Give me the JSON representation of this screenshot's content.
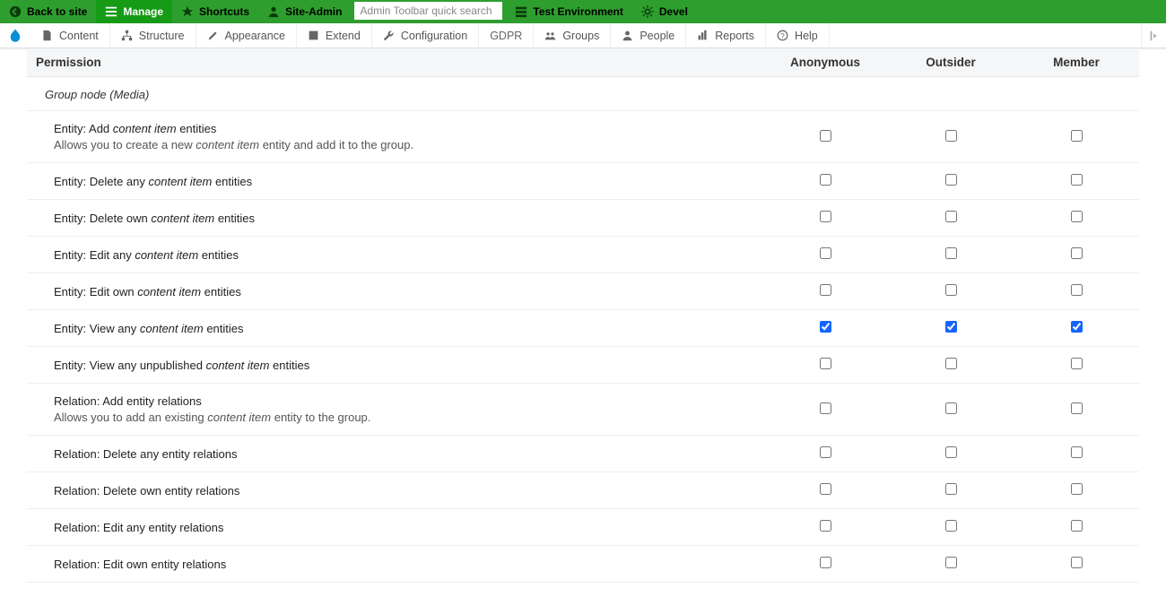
{
  "toolbar_top": {
    "back": "Back to site",
    "manage": "Manage",
    "shortcuts": "Shortcuts",
    "site_admin": "Site-Admin",
    "search_placeholder": "Admin Toolbar quick search",
    "test_env": "Test Environment",
    "devel": "Devel"
  },
  "toolbar_sub": {
    "content": "Content",
    "structure": "Structure",
    "appearance": "Appearance",
    "extend": "Extend",
    "configuration": "Configuration",
    "gdpr": "GDPR",
    "groups": "Groups",
    "people": "People",
    "reports": "Reports",
    "help": "Help"
  },
  "table": {
    "header_permission": "Permission",
    "roles": [
      "Anonymous",
      "Outsider",
      "Member"
    ],
    "section": "Group node (Media)",
    "rows": [
      {
        "title_pre": "Entity: Add ",
        "title_em": "content item",
        "title_post": " entities",
        "desc_pre": "Allows you to create a new ",
        "desc_em": "content item",
        "desc_post": " entity and add it to the group.",
        "checks": [
          false,
          false,
          false
        ]
      },
      {
        "title_pre": "Entity: Delete any ",
        "title_em": "content item",
        "title_post": " entities",
        "checks": [
          false,
          false,
          false
        ]
      },
      {
        "title_pre": "Entity: Delete own ",
        "title_em": "content item",
        "title_post": " entities",
        "checks": [
          false,
          false,
          false
        ]
      },
      {
        "title_pre": "Entity: Edit any ",
        "title_em": "content item",
        "title_post": " entities",
        "checks": [
          false,
          false,
          false
        ]
      },
      {
        "title_pre": "Entity: Edit own ",
        "title_em": "content item",
        "title_post": " entities",
        "checks": [
          false,
          false,
          false
        ]
      },
      {
        "title_pre": "Entity: View any ",
        "title_em": "content item",
        "title_post": " entities",
        "checks": [
          true,
          true,
          true
        ]
      },
      {
        "title_pre": "Entity: View any unpublished ",
        "title_em": "content item",
        "title_post": " entities",
        "checks": [
          false,
          false,
          false
        ]
      },
      {
        "title_pre": "Relation: Add entity relations",
        "title_em": "",
        "title_post": "",
        "desc_pre": "Allows you to add an existing ",
        "desc_em": "content item",
        "desc_post": " entity to the group.",
        "checks": [
          false,
          false,
          false
        ]
      },
      {
        "title_pre": "Relation: Delete any entity relations",
        "title_em": "",
        "title_post": "",
        "checks": [
          false,
          false,
          false
        ]
      },
      {
        "title_pre": "Relation: Delete own entity relations",
        "title_em": "",
        "title_post": "",
        "checks": [
          false,
          false,
          false
        ]
      },
      {
        "title_pre": "Relation: Edit any entity relations",
        "title_em": "",
        "title_post": "",
        "checks": [
          false,
          false,
          false
        ]
      },
      {
        "title_pre": "Relation: Edit own entity relations",
        "title_em": "",
        "title_post": "",
        "checks": [
          false,
          false,
          false
        ]
      }
    ]
  }
}
